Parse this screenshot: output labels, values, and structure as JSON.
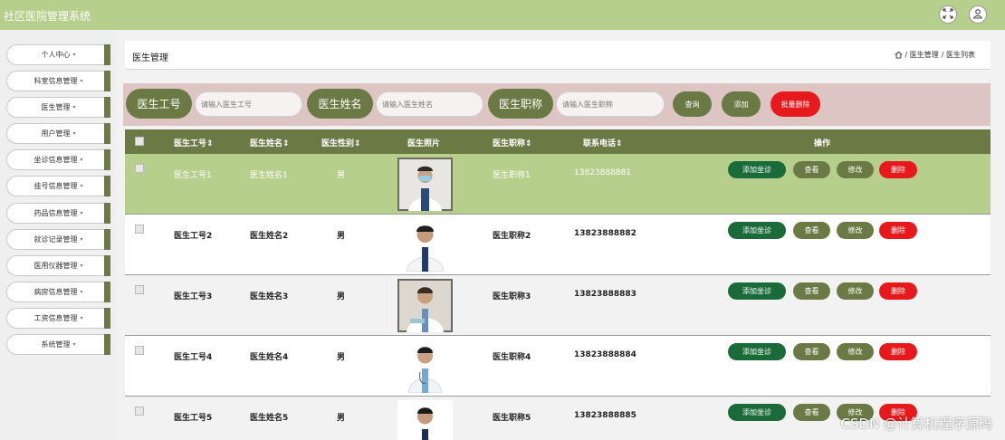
{
  "app": {
    "title": "社区医院管理系统"
  },
  "topbar": {
    "fullscreen_icon": "fullscreen-icon",
    "user_icon": "user-icon"
  },
  "sidebar": {
    "items": [
      {
        "label": "个人中心"
      },
      {
        "label": "科室信息管理"
      },
      {
        "label": "医生管理"
      },
      {
        "label": "用户管理"
      },
      {
        "label": "坐诊信息管理"
      },
      {
        "label": "挂号信息管理"
      },
      {
        "label": "药品信息管理"
      },
      {
        "label": "就诊记录管理"
      },
      {
        "label": "医用仪器管理"
      },
      {
        "label": "病房信息管理"
      },
      {
        "label": "工资信息管理"
      },
      {
        "label": "系统管理"
      }
    ],
    "caret": "▾"
  },
  "header": {
    "title": "医生管理",
    "breadcrumb": {
      "home_icon": "home-icon",
      "part1": "/ 医生管理",
      "part2": "/ 医生列表"
    }
  },
  "search": {
    "fields": [
      {
        "label": "医生工号",
        "placeholder": "请输入医生工号"
      },
      {
        "label": "医生姓名",
        "placeholder": "请输入医生姓名"
      },
      {
        "label": "医生职称",
        "placeholder": "请输入医生职称"
      }
    ],
    "buttons": {
      "query": "查询",
      "add": "添加",
      "batch_delete": "批量删除"
    }
  },
  "table": {
    "columns": [
      "医生工号",
      "医生姓名",
      "医生性别",
      "医生照片",
      "医生职称",
      "联系电话",
      "操作"
    ],
    "sort_icon": "⇕",
    "rows": [
      {
        "id": "医生工号1",
        "name": "医生姓名1",
        "gender": "男",
        "title": "医生职称1",
        "phone": "13823888881"
      },
      {
        "id": "医生工号2",
        "name": "医生姓名2",
        "gender": "男",
        "title": "医生职称2",
        "phone": "13823888882"
      },
      {
        "id": "医生工号3",
        "name": "医生姓名3",
        "gender": "男",
        "title": "医生职称3",
        "phone": "13823888883"
      },
      {
        "id": "医生工号4",
        "name": "医生姓名4",
        "gender": "男",
        "title": "医生职称4",
        "phone": "13823888884"
      },
      {
        "id": "医生工号5",
        "name": "医生姓名5",
        "gender": "男",
        "title": "医生职称5",
        "phone": "13823888885"
      }
    ],
    "actions": {
      "add_schedule": "添加坐诊",
      "view": "查看",
      "edit": "修改",
      "delete": "删除"
    }
  },
  "watermark": "CSDN @计算机程序源码",
  "colors": {
    "topbar": "#b7cf8d",
    "accent_olive": "#6b7a45",
    "search_panel": "#ddc5c3",
    "selected_row": "#b7cf8d",
    "add_schedule_green": "#1b6b3a",
    "delete_red": "#e8191c"
  }
}
